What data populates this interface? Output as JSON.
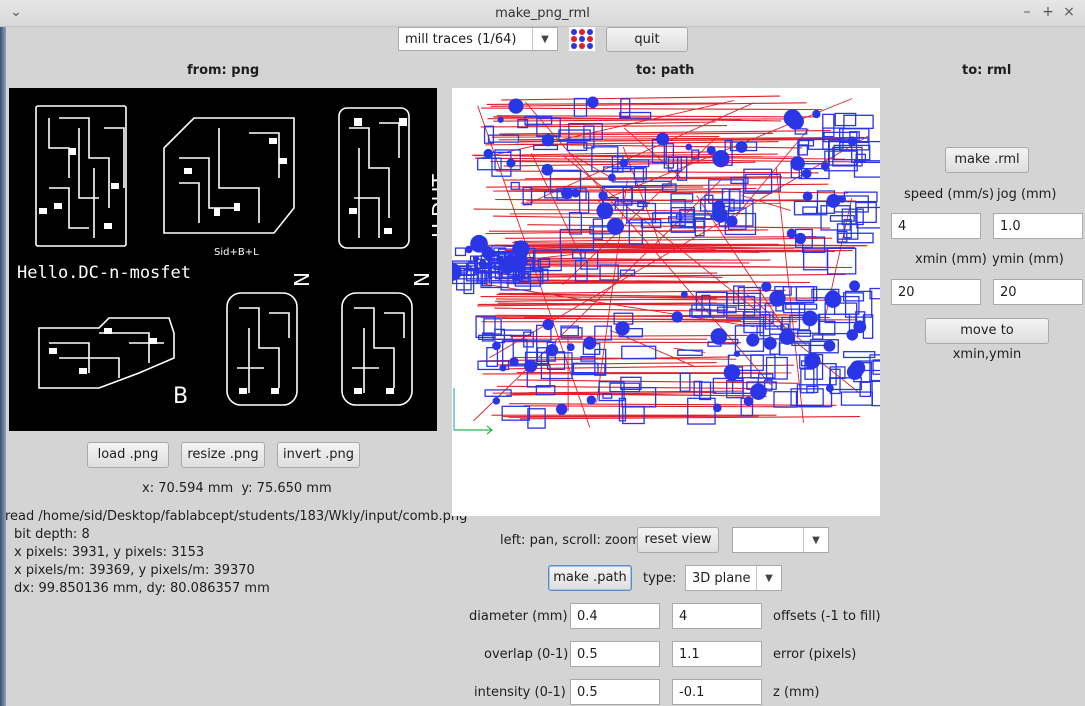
{
  "window": {
    "title": "make_png_rml"
  },
  "toolbar": {
    "mode_select": "mill traces (1/64)",
    "quit_label": "quit"
  },
  "sections": {
    "from": "from: png",
    "to_path": "to: path",
    "to_rml": "to: rml"
  },
  "png_panel": {
    "load_label": "load .png",
    "resize_label": "resize .png",
    "invert_label": "invert .png",
    "coords": "x: 70.594 mm  y: 75.650 mm",
    "info": [
      "read /home/sid/Desktop/fablabcept/students/183/Wkly/input/comb.png",
      "bit depth: 8",
      "x pixels: 3931, y pixels: 3153",
      "x pixels/m: 39369, y pixels/m: 39370",
      "dx: 99.850136 mm, dy: 80.086357 mm"
    ],
    "board_labels": {
      "mosfet": "Hello.DC-n-mosfet",
      "sid": "Sid+B+L",
      "dht": "H.DHT",
      "n1": "N",
      "n2": "N",
      "b": "B"
    }
  },
  "path_panel": {
    "hint": "left: pan, scroll: zoom",
    "reset_label": "reset view",
    "view_select": "",
    "make_path_label": "make .path",
    "type_label": "type:",
    "type_select": "3D plane",
    "diameter_label": "diameter (mm)",
    "diameter_value": "0.4",
    "offsets_value": "4",
    "offsets_label": "offsets (-1 to fill)",
    "overlap_label": "overlap (0-1)",
    "overlap_value": "0.5",
    "error_value": "1.1",
    "error_label": "error (pixels)",
    "intensity_label": "intensity (0-1)",
    "intensity_value": "0.5",
    "z_value": "-0.1",
    "z_label": "z (mm)"
  },
  "rml_panel": {
    "make_rml_label": "make .rml",
    "speed_label": "speed (mm/s)",
    "jog_label": "jog (mm)",
    "speed_value": "4",
    "jog_value": "1.0",
    "xmin_label": "xmin (mm)",
    "ymin_label": "ymin (mm)",
    "xmin_value": "20",
    "ymin_value": "20",
    "move_label": "move to xmin,ymin"
  },
  "colors": {
    "toolpath_red": "#e0202a",
    "toolpath_blue": "#2a35e6",
    "canvas_bg": "#ffffff",
    "image_bg": "#000000"
  }
}
